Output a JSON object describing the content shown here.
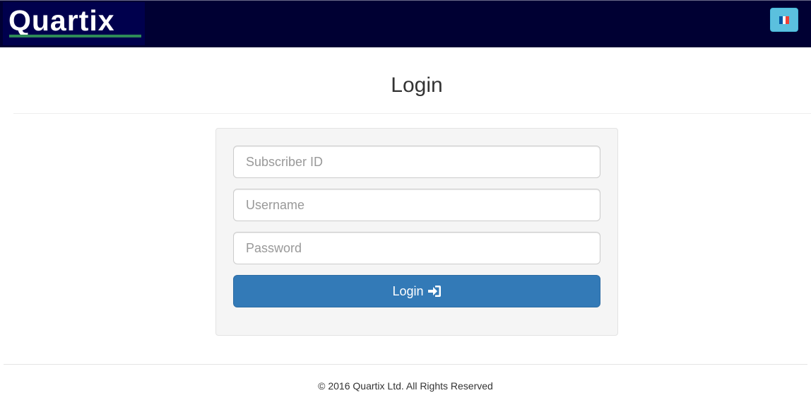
{
  "header": {
    "logo_text": "Quartix",
    "language_button": {
      "icon": "french-flag-icon",
      "flag_colors": [
        "#0055a4",
        "#ffffff",
        "#ef4135"
      ]
    },
    "background_color": "#000033"
  },
  "main": {
    "title": "Login",
    "form": {
      "subscriber_id": {
        "value": "",
        "placeholder": "Subscriber ID"
      },
      "username": {
        "value": "",
        "placeholder": "Username"
      },
      "password": {
        "value": "",
        "placeholder": "Password"
      },
      "submit_label": "Login",
      "submit_icon": "sign-in-icon",
      "submit_color": "#337ab7"
    }
  },
  "footer": {
    "copyright": "© 2016 Quartix Ltd. All Rights Reserved"
  }
}
